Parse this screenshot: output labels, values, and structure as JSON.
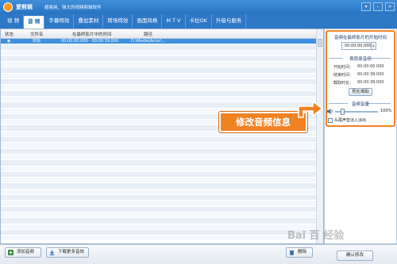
{
  "app": {
    "name": "爱剪辑",
    "slogan": "超易用、强大的视频剪辑软件",
    "accent": "#2e78c6"
  },
  "tabs": [
    "视 频",
    "音 频",
    "字幕特效",
    "叠加素材",
    "转场特效",
    "画面风格",
    "M T V",
    "卡拉OK",
    "升级与服务"
  ],
  "table": {
    "headers": [
      "状态",
      "文件名",
      "在最终影片中的时间",
      "路径"
    ],
    "rows": [
      {
        "status": "◉",
        "filename": "欢快",
        "time": "00:00:00.000 - 00:00:39.000",
        "path": "D:\\Media\\Actor\\..."
      }
    ],
    "selected_color": "#3d8fe0"
  },
  "panel": {
    "start_heading": "音频在最终影片的开始时间",
    "start_time": "00:00:00.000",
    "clip_heading": "裁剪原音频",
    "start_label": "开始时间：",
    "start_value": "00:00:00.000",
    "end_label": "结束时间：",
    "end_value": "00:00:39.000",
    "duration_label": "截取时长：",
    "duration_value": "00:00:39.000",
    "preview_button": "预览/截取",
    "volume_heading": "音频音量",
    "volume_percent": "100%",
    "fade_label": "头尾声音淡入淡出"
  },
  "callout": {
    "text": "修改音频信息",
    "color": "#f08224"
  },
  "bottom": {
    "add_audio": "添加音频",
    "download_more": "下载更多音效",
    "delete": "删除",
    "confirm": "确认修改"
  },
  "watermark": "Bai 百 经验"
}
